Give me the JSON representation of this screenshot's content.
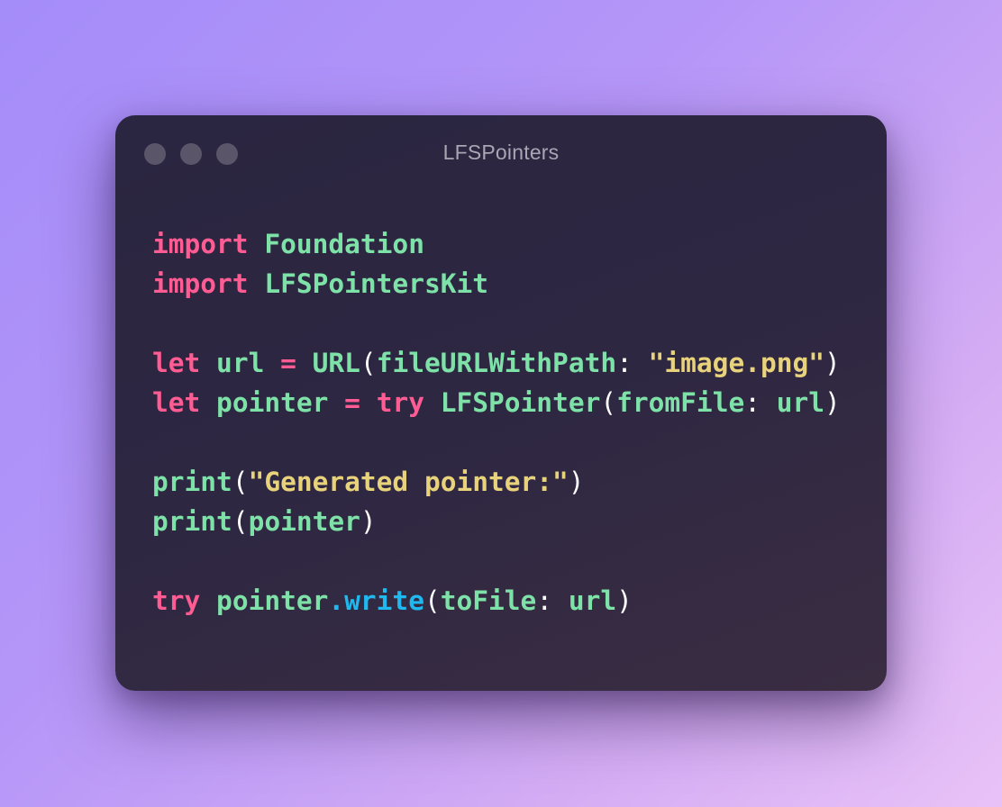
{
  "background": {
    "gradient_start": "#a48cf9",
    "gradient_end": "#e8c2f7"
  },
  "window": {
    "title": "LFSPointers",
    "background_color": "#2a2540",
    "traffic_lights": [
      "close",
      "minimize",
      "zoom"
    ]
  },
  "theme": {
    "keyword": "#ff5c93",
    "identifier": "#7ee2a8",
    "string": "#e8d27b",
    "method": "#1fb8ef",
    "punctuation": "#ffffff"
  },
  "code": {
    "language": "swift",
    "lines": [
      [
        {
          "t": "import",
          "k": "kw"
        },
        {
          "t": " ",
          "k": "tp"
        },
        {
          "t": "Foundation",
          "k": "tp"
        }
      ],
      [
        {
          "t": "import",
          "k": "kw"
        },
        {
          "t": " ",
          "k": "tp"
        },
        {
          "t": "LFSPointersKit",
          "k": "tp"
        }
      ],
      [],
      [
        {
          "t": "let",
          "k": "kw"
        },
        {
          "t": " url ",
          "k": "tp"
        },
        {
          "t": "=",
          "k": "op"
        },
        {
          "t": " URL",
          "k": "tp"
        },
        {
          "t": "(",
          "k": "pn"
        },
        {
          "t": "fileURLWithPath",
          "k": "tp"
        },
        {
          "t": ": ",
          "k": "pn"
        },
        {
          "t": "\"image.png\"",
          "k": "str"
        },
        {
          "t": ")",
          "k": "pn"
        }
      ],
      [
        {
          "t": "let",
          "k": "kw"
        },
        {
          "t": " pointer ",
          "k": "tp"
        },
        {
          "t": "=",
          "k": "op"
        },
        {
          "t": " ",
          "k": "tp"
        },
        {
          "t": "try",
          "k": "kw"
        },
        {
          "t": " LFSPointer",
          "k": "tp"
        },
        {
          "t": "(",
          "k": "pn"
        },
        {
          "t": "fromFile",
          "k": "tp"
        },
        {
          "t": ": ",
          "k": "pn"
        },
        {
          "t": "url",
          "k": "tp"
        },
        {
          "t": ")",
          "k": "pn"
        }
      ],
      [],
      [
        {
          "t": "print",
          "k": "tp"
        },
        {
          "t": "(",
          "k": "pn"
        },
        {
          "t": "\"Generated pointer:\"",
          "k": "str"
        },
        {
          "t": ")",
          "k": "pn"
        }
      ],
      [
        {
          "t": "print",
          "k": "tp"
        },
        {
          "t": "(",
          "k": "pn"
        },
        {
          "t": "pointer",
          "k": "tp"
        },
        {
          "t": ")",
          "k": "pn"
        }
      ],
      [],
      [
        {
          "t": "try",
          "k": "kw"
        },
        {
          "t": " pointer",
          "k": "tp"
        },
        {
          "t": ".write",
          "k": "fn"
        },
        {
          "t": "(",
          "k": "pn"
        },
        {
          "t": "toFile",
          "k": "tp"
        },
        {
          "t": ": ",
          "k": "pn"
        },
        {
          "t": "url",
          "k": "tp"
        },
        {
          "t": ")",
          "k": "pn"
        }
      ]
    ]
  }
}
